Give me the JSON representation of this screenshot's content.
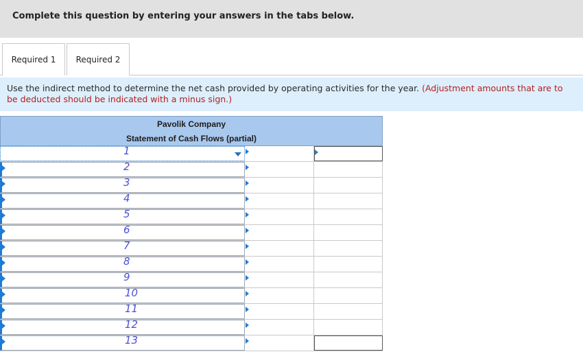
{
  "header": {
    "instruction": "Complete this question by entering your answers in the tabs below."
  },
  "tabs": [
    {
      "label": "Required 1",
      "active": true
    },
    {
      "label": "Required 2",
      "active": false
    }
  ],
  "question": {
    "text": "Use the indirect method to determine the net cash provided by operating activities for the year.",
    "note": "(Adjustment amounts that are to be deducted should be indicated with a minus sign.)"
  },
  "statement": {
    "company": "Pavolik Company",
    "title": "Statement of Cash Flows (partial)",
    "rows": [
      {
        "description": "",
        "amount1": "",
        "amount2": ""
      },
      {
        "description": "",
        "amount1": "",
        "amount2": ""
      },
      {
        "description": "",
        "amount1": "",
        "amount2": ""
      },
      {
        "description": "",
        "amount1": "",
        "amount2": ""
      },
      {
        "description": "",
        "amount1": "",
        "amount2": ""
      },
      {
        "description": "",
        "amount1": "",
        "amount2": ""
      },
      {
        "description": "",
        "amount1": "",
        "amount2": ""
      },
      {
        "description": "",
        "amount1": "",
        "amount2": ""
      },
      {
        "description": "",
        "amount1": "",
        "amount2": ""
      },
      {
        "description": "",
        "amount1": "",
        "amount2": ""
      },
      {
        "description": "",
        "amount1": "",
        "amount2": ""
      },
      {
        "description": "",
        "amount1": "",
        "amount2": ""
      },
      {
        "description": "",
        "amount1": "",
        "amount2": ""
      }
    ]
  },
  "annotations": {
    "handwritten_numbers": [
      "1",
      "2",
      "3",
      "4",
      "5",
      "6",
      "7",
      "8",
      "9",
      "10",
      "11",
      "12",
      "13"
    ],
    "color": "#4a52d8"
  },
  "colors": {
    "header_bg": "#e1e1e1",
    "instruction_bg": "#ddeefc",
    "table_header_bg": "#a9c8ed",
    "note_red": "#b3211e",
    "input_accent": "#1e7bd6"
  }
}
